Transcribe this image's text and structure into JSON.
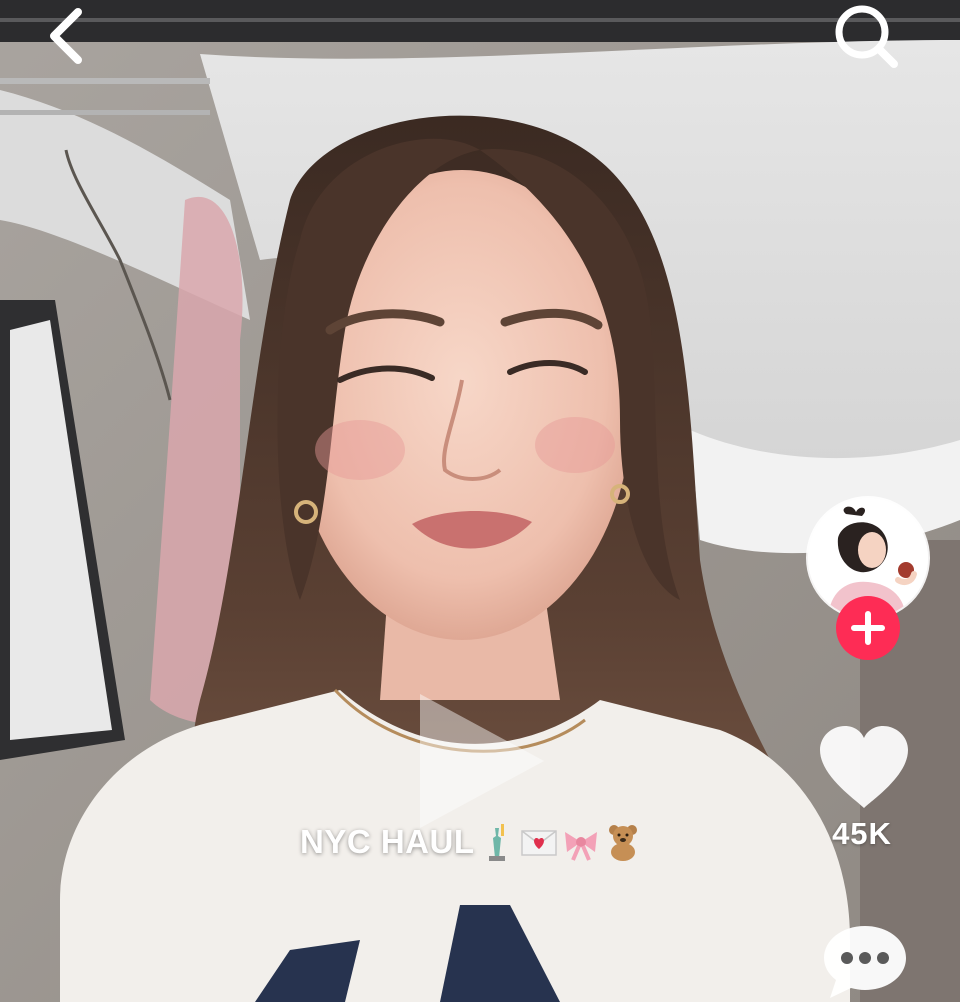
{
  "video": {
    "caption": {
      "text": "NYC HAUL",
      "emoji": [
        "statue-of-liberty-emoji",
        "love-letter-emoji",
        "ribbon-emoji",
        "teddy-bear-emoji"
      ]
    },
    "state": "paused"
  },
  "top_bar": {
    "back_icon": "chevron-left-icon",
    "search_icon": "search-icon"
  },
  "creator": {
    "avatar_icon": "avatar",
    "follow_icon": "plus-icon"
  },
  "actions": {
    "like": {
      "icon": "heart-icon",
      "count": "45K"
    },
    "more": {
      "icon": "ellipsis-icon"
    }
  },
  "colors": {
    "follow_red": "#fe2c55",
    "overlay_white": "#ffffff"
  }
}
